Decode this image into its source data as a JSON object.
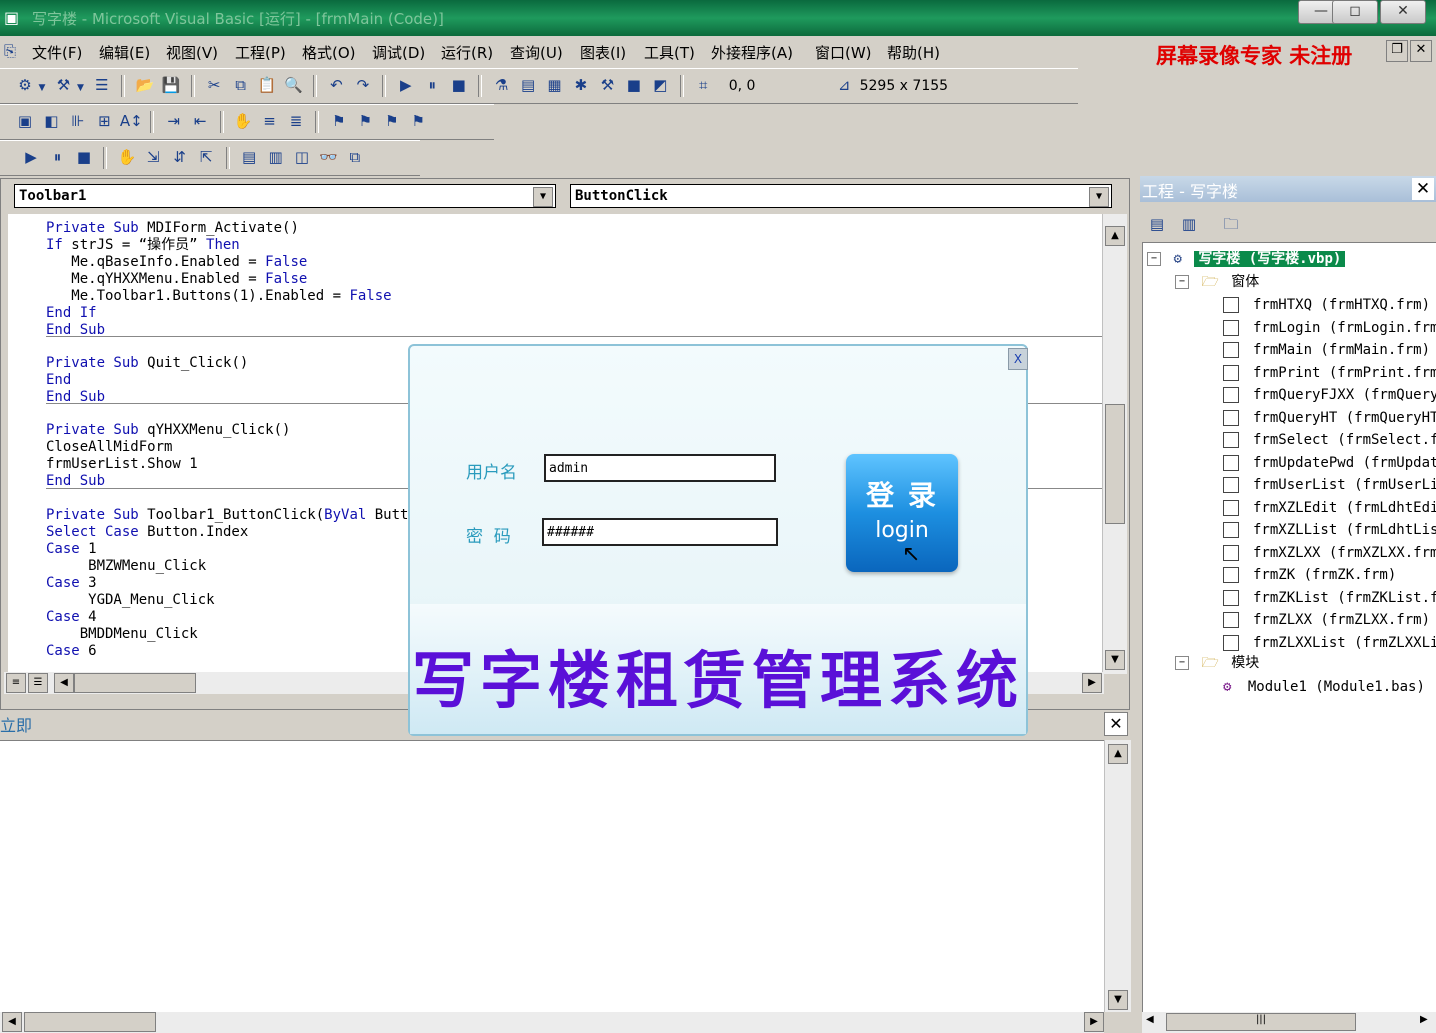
{
  "window": {
    "title": "写字楼 - Microsoft Visual Basic [运行] - [frmMain (Code)]",
    "minimize": "—",
    "restore": "◻",
    "close": "✕"
  },
  "menu": [
    "文件(F)",
    "编辑(E)",
    "视图(V)",
    "工程(P)",
    "格式(O)",
    "调试(D)",
    "运行(R)",
    "查询(U)",
    "图表(I)",
    "工具(T)",
    "外接程序(A)",
    "窗口(W)",
    "帮助(H)"
  ],
  "watermark": "屏幕录像专家 未注册",
  "toolbar": {
    "position": "0, 0",
    "size": "5295 x 7155"
  },
  "code_window": {
    "object_combo": "Toolbar1",
    "procedure_combo": "ButtonClick",
    "lines": [
      {
        "t": "Private Sub MDIForm_Activate()"
      },
      {
        "t": "If strJS = \"操作员\" Then"
      },
      {
        "t": "   Me.qBaseInfo.Enabled = False"
      },
      {
        "t": "   Me.qYHXXMenu.Enabled = False"
      },
      {
        "t": "   Me.Toolbar1.Buttons(1).Enabled = False"
      },
      {
        "t": "End If"
      },
      {
        "t": "End Sub"
      },
      {
        "t": "Private Sub Quit_Click()"
      },
      {
        "t": "End"
      },
      {
        "t": "End Sub"
      },
      {
        "t": "Private Sub qYHXXMenu_Click()"
      },
      {
        "t": "CloseAllMidForm"
      },
      {
        "t": "frmUserList.Show 1"
      },
      {
        "t": "End Sub"
      },
      {
        "t": "Private Sub Toolbar1_ButtonClick(ByVal Butt"
      },
      {
        "t": "Select Case Button.Index"
      },
      {
        "t": "Case 1"
      },
      {
        "t": "     BMZWMenu_Click"
      },
      {
        "t": "Case 3"
      },
      {
        "t": "     YGDA_Menu_Click"
      },
      {
        "t": "Case 4"
      },
      {
        "t": "    BMDDMenu_Click"
      },
      {
        "t": "Case 6"
      }
    ]
  },
  "immediate": {
    "title": "立即"
  },
  "project": {
    "title": "工程 - 写字楼",
    "root": "写字楼 (写字楼.vbp)",
    "forms_folder": "窗体",
    "forms": [
      "frmHTXQ (frmHTXQ.frm)",
      "frmLogin (frmLogin.frm",
      "frmMain (frmMain.frm)",
      "frmPrint (frmPrint.frm",
      "frmQueryFJXX (frmQuery",
      "frmQueryHT (frmQueryHT",
      "frmSelect (frmSelect.f",
      "frmUpdatePwd (frmUpdat",
      "frmUserList (frmUserLi",
      "frmXZLEdit (frmLdhtEdi",
      "frmXZLList (frmLdhtLis",
      "frmXZLXX (frmXZLXX.frm",
      "frmZK (frmZK.frm)",
      "frmZKList (frmZKList.f",
      "frmZLXX (frmZLXX.frm)",
      "frmZLXXList (frmZLXXLi"
    ],
    "modules_folder": "模块",
    "modules": [
      "Module1 (Module1.bas)"
    ]
  },
  "login": {
    "close": "X",
    "username_label": "用户名",
    "username_value": "admin",
    "password_label": "密  码",
    "password_value": "######",
    "button_cn": "登 录",
    "button_en": "login",
    "system_title": "写字楼租赁管理系统"
  }
}
